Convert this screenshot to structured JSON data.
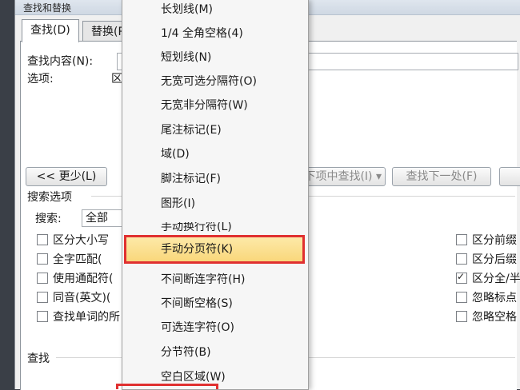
{
  "dialog": {
    "title": "查找和替换",
    "tabs": [
      {
        "label": "查找(D)",
        "active": true
      },
      {
        "label": "替换(P)",
        "active": false
      }
    ],
    "find_label": "查找内容(N):",
    "options_label": "选项:",
    "options_value": "区",
    "more_button": "<< 更少(L)",
    "find_in_button": "在以下项中查找(I)",
    "find_next_button": "查找下一处(F)",
    "search_options_title": "搜索选项",
    "search_label": "搜索:",
    "search_value": "全部",
    "left_checkboxes": [
      {
        "label": "区分大小写",
        "checked": false
      },
      {
        "label": "全字匹配(",
        "checked": false
      },
      {
        "label": "使用通配符(",
        "checked": false
      },
      {
        "label": "同音(英文)(",
        "checked": false
      },
      {
        "label": "查找单词的所",
        "checked": false
      }
    ],
    "right_checkboxes": [
      {
        "label": "区分前缀",
        "checked": false
      },
      {
        "label": "区分后缀",
        "checked": false
      },
      {
        "label": "区分全/半",
        "checked": true
      },
      {
        "label": "忽略标点",
        "checked": false
      },
      {
        "label": "忽略空格",
        "checked": false
      }
    ],
    "find_section_title": "查找"
  },
  "menu": {
    "items": [
      {
        "label": "长划线(M)"
      },
      {
        "label": "1/4 全角空格(4)"
      },
      {
        "label": "短划线(N)"
      },
      {
        "label": "无宽可选分隔符(O)"
      },
      {
        "label": "无宽非分隔符(W)"
      },
      {
        "label": "尾注标记(E)"
      },
      {
        "label": "域(D)"
      },
      {
        "label": "脚注标记(F)"
      },
      {
        "label": "图形(I)"
      },
      {
        "label": "手动换行符(L)"
      },
      {
        "label": "手动分页符(K)"
      },
      {
        "label": "不间断连字符(H)"
      },
      {
        "label": "不间断空格(S)"
      },
      {
        "label": "可选连字符(O)"
      },
      {
        "label": "分节符(B)"
      },
      {
        "label": "空白区域(W)"
      }
    ]
  },
  "colors": {
    "highlight_border": "#e03030",
    "highlight_fill": "#f9d77b"
  }
}
